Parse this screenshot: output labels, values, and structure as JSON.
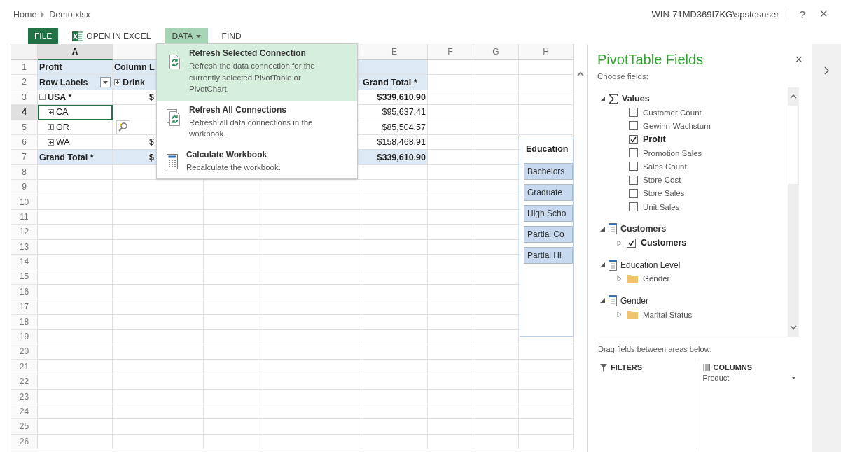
{
  "topbar": {
    "breadcrumb": [
      {
        "label": "Home"
      },
      {
        "label": "Demo.xlsx"
      }
    ],
    "user": "WIN-71MD369I7KG\\spstesuser",
    "help": "?",
    "close": "✕"
  },
  "ribbon": [
    {
      "label": "FILE",
      "kind": "file",
      "selected": false
    },
    {
      "label": "OPEN IN EXCEL",
      "kind": "excel",
      "selected": false
    },
    {
      "label": "DATA",
      "kind": "dropdown",
      "selected": true
    },
    {
      "label": "FIND",
      "kind": "plain",
      "selected": false
    }
  ],
  "data_menu": [
    {
      "title": "Refresh Selected Connection",
      "description": "Refresh the data connection for the currently selected PivotTable or PivotChart.",
      "kind": "refresh",
      "selected": true
    },
    {
      "title": "Refresh All Connections",
      "description": "Refresh all data connections in the workbook.",
      "kind": "refresh_all",
      "selected": false
    },
    {
      "title": "Calculate Workbook",
      "description": "Recalculate the workbook.",
      "kind": "calculate",
      "selected": false
    }
  ],
  "columns": [
    {
      "label": "A",
      "selected": true
    },
    {
      "selected": false
    },
    {},
    {},
    {
      "label": "E",
      "selected": false
    },
    {
      "label": "F",
      "selected": false
    },
    {
      "label": "G",
      "selected": false
    },
    {
      "label": "H",
      "selected": false
    }
  ],
  "rows": [
    {
      "number": "1",
      "selected": false,
      "band": true,
      "cells": {
        "a": {
          "text": "Profit",
          "kind": "label",
          "bold": true,
          "selected": false
        },
        "b": {
          "text": "Column L",
          "kind": "label",
          "bold": true,
          "selected": false
        }
      }
    },
    {
      "number": "2",
      "selected": false,
      "band": true,
      "cells": {
        "a": {
          "text": "Row Labels",
          "kind": "filter_label",
          "bold": true,
          "selected": false
        },
        "b": {
          "text": "Drink",
          "kind": "label",
          "bold": true,
          "expanded": false,
          "selected": false
        },
        "e": {
          "text": "Grand Total *",
          "kind": "label",
          "bold": true,
          "selected": false
        }
      }
    },
    {
      "number": "3",
      "selected": false,
      "band": false,
      "cells": {
        "a": {
          "text": "USA *",
          "kind": "label",
          "bold": true,
          "expanded": true,
          "selected": false
        },
        "b": {
          "text": "$",
          "kind": "accounting",
          "bold": true,
          "selected": false
        },
        "e": {
          "text": "$339,610.90",
          "kind": "money",
          "bold": true,
          "selected": false
        }
      }
    },
    {
      "number": "4",
      "selected": true,
      "band": false,
      "cells": {
        "a": {
          "text": "CA",
          "kind": "sublabel",
          "bold": false,
          "expanded": false,
          "selected": true
        },
        "e": {
          "text": "$95,637.41",
          "kind": "money",
          "bold": false,
          "selected": false
        }
      }
    },
    {
      "number": "5",
      "selected": false,
      "band": false,
      "cells": {
        "a": {
          "text": "OR",
          "kind": "sublabel",
          "bold": false,
          "expanded": false,
          "selected": false
        },
        "b": {
          "kind": "lens",
          "selected": false
        },
        "e": {
          "text": "$85,504.57",
          "kind": "money",
          "bold": false,
          "selected": false
        }
      }
    },
    {
      "number": "6",
      "selected": false,
      "band": false,
      "cells": {
        "a": {
          "text": "WA",
          "kind": "sublabel",
          "bold": false,
          "expanded": false,
          "selected": false
        },
        "b": {
          "text": "$",
          "kind": "accounting",
          "bold": false,
          "selected": false
        },
        "e": {
          "text": "$158,468.91",
          "kind": "money",
          "bold": false,
          "selected": false
        }
      }
    },
    {
      "number": "7",
      "selected": false,
      "band": true,
      "cells": {
        "a": {
          "text": "Grand Total *",
          "kind": "label",
          "bold": true,
          "selected": false
        },
        "b": {
          "text": "$",
          "kind": "accounting",
          "bold": true,
          "selected": false
        },
        "e": {
          "text": "$339,610.90",
          "kind": "money",
          "bold": true,
          "selected": false
        }
      }
    },
    {
      "number": "8",
      "selected": false,
      "band": false
    },
    {
      "number": "9",
      "selected": false,
      "band": false
    },
    {
      "number": "10",
      "selected": false,
      "band": false
    },
    {
      "number": "11",
      "selected": false,
      "band": false
    },
    {
      "number": "12",
      "selected": false,
      "band": false
    },
    {
      "number": "13",
      "selected": false,
      "band": false
    },
    {
      "number": "14",
      "selected": false,
      "band": false
    },
    {
      "number": "15",
      "selected": false,
      "band": false
    },
    {
      "number": "16",
      "selected": false,
      "band": false
    },
    {
      "number": "17",
      "selected": false,
      "band": false
    },
    {
      "number": "18",
      "selected": false,
      "band": false
    },
    {
      "number": "19",
      "selected": false,
      "band": false
    },
    {
      "number": "20",
      "selected": false,
      "band": false
    },
    {
      "number": "21",
      "selected": false,
      "band": false
    },
    {
      "number": "22",
      "selected": false,
      "band": false
    },
    {
      "number": "23",
      "selected": false,
      "band": false
    },
    {
      "number": "24",
      "selected": false,
      "band": false
    },
    {
      "number": "25",
      "selected": false,
      "band": false
    },
    {
      "number": "26",
      "selected": false,
      "band": false
    }
  ],
  "slicer": {
    "title": "Education",
    "items": [
      {
        "label": "Bachelors",
        "selected": true
      },
      {
        "label": "Graduate",
        "selected": true
      },
      {
        "label": "High Scho",
        "selected": true
      },
      {
        "label": "Partial Co",
        "selected": true
      },
      {
        "label": "Partial Hi",
        "selected": true
      }
    ]
  },
  "pivot_panel": {
    "title": "PivotTable Fields",
    "close": "×",
    "subtitle": "Choose fields:",
    "fields": [
      {
        "label": "Values",
        "kind": "values",
        "expanded": true,
        "in_use": true,
        "children": [
          {
            "label": "Customer Count",
            "kind": "check",
            "checked": false
          },
          {
            "label": "Gewinn-Wachstum",
            "kind": "check",
            "checked": false
          },
          {
            "label": "Profit",
            "kind": "check",
            "checked": true
          },
          {
            "label": "Promotion Sales",
            "kind": "check",
            "checked": false
          },
          {
            "label": "Sales Count",
            "kind": "check",
            "checked": false
          },
          {
            "label": "Store Cost",
            "kind": "check",
            "checked": false
          },
          {
            "label": "Store Sales",
            "kind": "check",
            "checked": false
          },
          {
            "label": "Unit Sales",
            "kind": "check",
            "checked": false
          }
        ]
      },
      {
        "label": "Customers",
        "kind": "table",
        "expanded": true,
        "in_use": true,
        "children": [
          {
            "label": "Customers",
            "kind": "hierarchy",
            "checked": true,
            "expanded": false
          }
        ]
      },
      {
        "label": "Education Level",
        "kind": "table",
        "expanded": true,
        "in_use": false,
        "children": [
          {
            "label": "Gender",
            "kind": "folder",
            "expanded": false
          }
        ]
      },
      {
        "label": "Gender",
        "kind": "table",
        "expanded": true,
        "in_use": false,
        "children": [
          {
            "label": "Marital Status",
            "kind": "folder",
            "expanded": false
          }
        ]
      }
    ],
    "areas_hint": "Drag fields between areas below:",
    "areas": [
      {
        "label": "FILTERS",
        "kind": "filters"
      },
      {
        "label": "COLUMNS",
        "kind": "columns",
        "items": [
          "Product"
        ]
      }
    ]
  }
}
